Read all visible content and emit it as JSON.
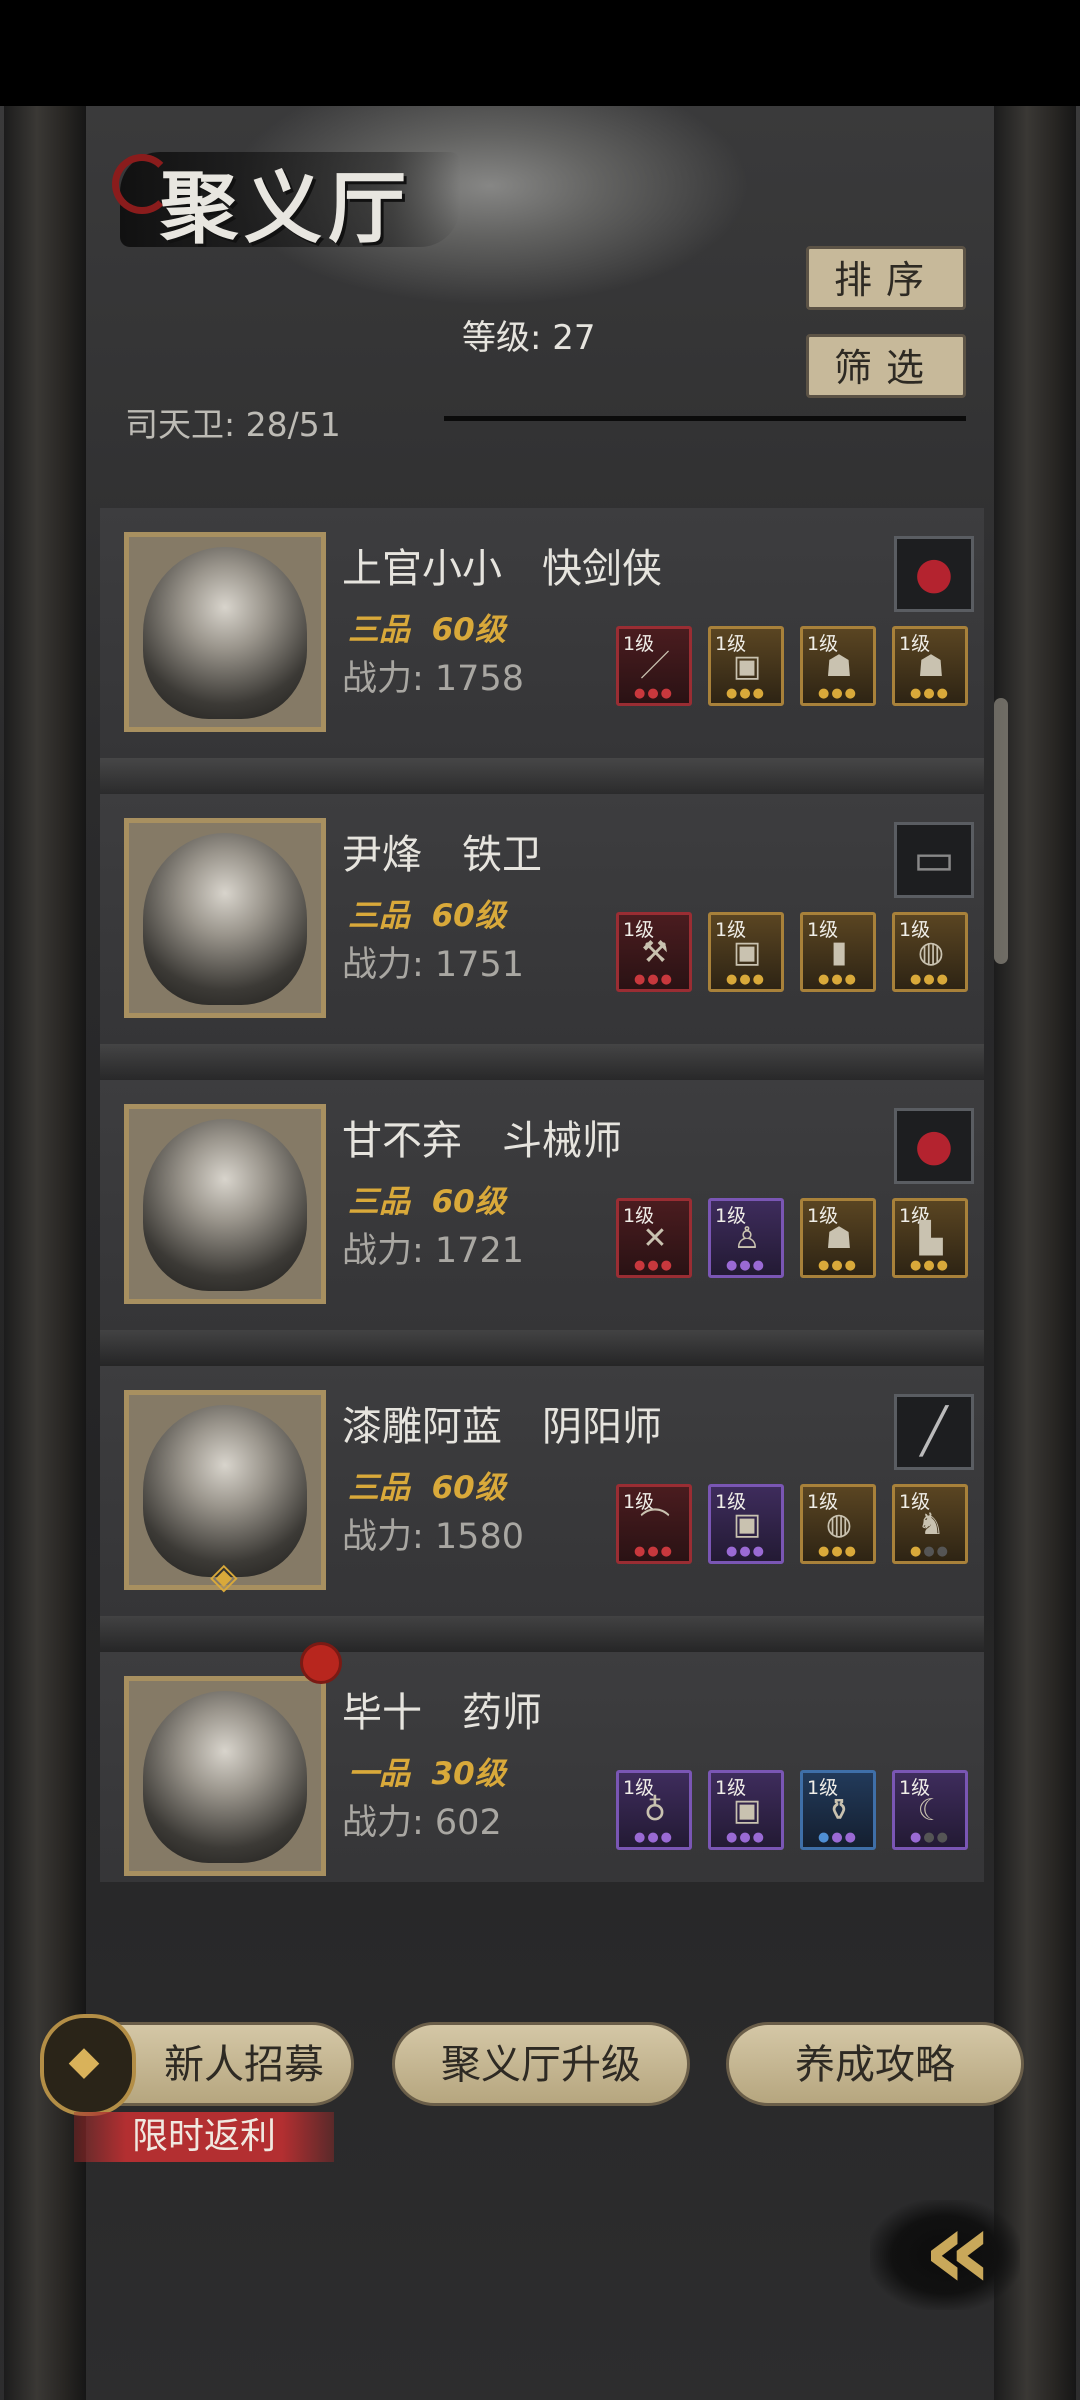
{
  "header": {
    "title": "聚义厅",
    "level_text": "等级: 27",
    "guards_text": "司天卫: 28/51",
    "sort_label": "排序",
    "filter_label": "筛选"
  },
  "heroes": [
    {
      "name": "上官小小　快剑侠",
      "rank": "三品  60级",
      "power": "战力: 1758",
      "special_icon": "red-cap-icon",
      "equipment": [
        {
          "level": "1级",
          "icon": "sword-icon",
          "quality": "red"
        },
        {
          "level": "1级",
          "icon": "armor-icon",
          "quality": "gold"
        },
        {
          "level": "1级",
          "icon": "mask-icon",
          "quality": "gold"
        },
        {
          "level": "1级",
          "icon": "mask-icon",
          "quality": "gold"
        }
      ]
    },
    {
      "name": "尹烽　铁卫",
      "rank": "三品  60级",
      "power": "战力: 1751",
      "special_icon": "chest-icon",
      "equipment": [
        {
          "level": "1级",
          "icon": "hammer-icon",
          "quality": "red"
        },
        {
          "level": "1级",
          "icon": "armor-icon",
          "quality": "gold"
        },
        {
          "level": "1级",
          "icon": "token-icon",
          "quality": "gold"
        },
        {
          "level": "1级",
          "icon": "pouch-icon",
          "quality": "gold"
        }
      ]
    },
    {
      "name": "甘不弃　斗械师",
      "rank": "三品  60级",
      "power": "战力: 1721",
      "special_icon": "red-cap-icon",
      "equipment": [
        {
          "level": "1级",
          "icon": "crossbow-icon",
          "quality": "red"
        },
        {
          "level": "1级",
          "icon": "robe-icon",
          "quality": "purple"
        },
        {
          "level": "1级",
          "icon": "mask-icon",
          "quality": "gold"
        },
        {
          "level": "1级",
          "icon": "boots-icon",
          "quality": "gold"
        }
      ]
    },
    {
      "name": "漆雕阿蓝　阴阳师",
      "rank": "三品  60级",
      "power": "战力: 1580",
      "special_icon": "needle-icon",
      "equipment": [
        {
          "level": "1级",
          "icon": "fan-icon",
          "quality": "red"
        },
        {
          "level": "1级",
          "icon": "vest-icon",
          "quality": "purple"
        },
        {
          "level": "1级",
          "icon": "pouch-icon",
          "quality": "gold"
        },
        {
          "level": "1级",
          "icon": "beast-icon",
          "quality": "gold"
        }
      ]
    },
    {
      "name": "毕十　药师",
      "rank": "一品  30级",
      "power": "战力: 602",
      "special_icon": "",
      "equipment": [
        {
          "level": "1级",
          "icon": "gourd-icon",
          "quality": "purple"
        },
        {
          "level": "1级",
          "icon": "vest-icon",
          "quality": "purple"
        },
        {
          "level": "1级",
          "icon": "pot-icon",
          "quality": "blue"
        },
        {
          "level": "1级",
          "icon": "claw-icon",
          "quality": "purple"
        }
      ]
    }
  ],
  "bottom": {
    "recruit_label": "新人招募",
    "recruit_promo": "限时返利",
    "upgrade_label": "聚义厅升级",
    "guide_label": "养成攻略"
  },
  "colors": {
    "accent_gold": "#d9a93a",
    "button_beige": "#c7b99a",
    "promo_red": "#b32f31"
  }
}
